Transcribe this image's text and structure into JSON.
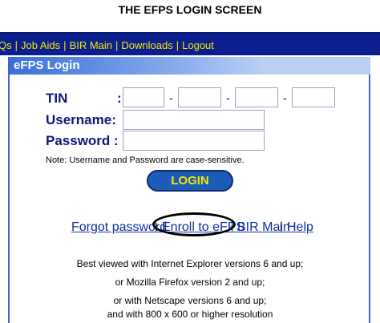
{
  "caption": "THE EFPS LOGIN SCREEN",
  "nav": {
    "items": [
      "Qs",
      "Job Aids",
      "BIR Main",
      "Downloads",
      "Logout"
    ]
  },
  "panel": {
    "title": "eFPS Login"
  },
  "form": {
    "tin_label": "TIN",
    "tin_colon": ":",
    "tin_dash": "-",
    "tin_values": [
      "",
      "",
      "",
      ""
    ],
    "username_label": "Username:",
    "username_value": "",
    "password_label": "Password :",
    "password_value": "",
    "note": "Note: Username and Password are case-sensitive.",
    "login_label": "LOGIN"
  },
  "links": {
    "forgot": "Forgot password",
    "enroll": "Enroll to eFPS",
    "bir_main": "BIR Main",
    "help": "Help",
    "separator": "|"
  },
  "footer": {
    "line1": "Best viewed with Internet Explorer versions 6 and up;",
    "line2": "or Mozilla Firefox version 2 and up;",
    "line3": "or with Netscape versions 6 and up;",
    "line4": "and with 800 x 600 or higher resolution"
  }
}
